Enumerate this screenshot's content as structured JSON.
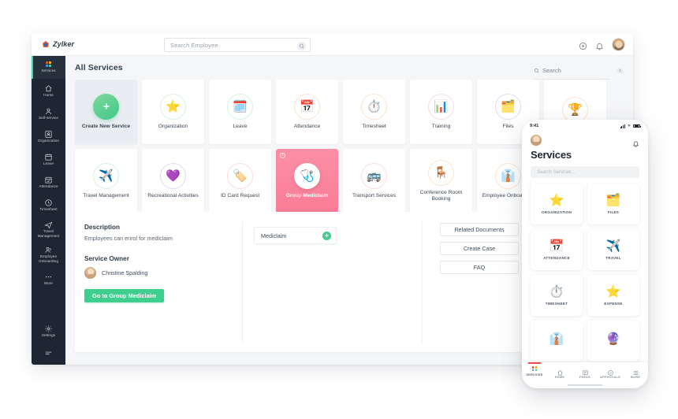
{
  "topbar": {
    "logo_text": "Zylker",
    "logo_icon": "zylker-logo-icon",
    "search_placeholder": "Search Employee",
    "search_value": "",
    "search_icon": "search-icon",
    "add_icon": "plus-circle-icon",
    "bell_icon": "bell-icon",
    "avatar": "user-avatar"
  },
  "sidebar": {
    "items": [
      {
        "label": "Services",
        "icon": "grid-dots-icon",
        "active": true
      },
      {
        "label": "Home",
        "icon": "home-icon",
        "active": false
      },
      {
        "label": "Self-service",
        "icon": "person-icon",
        "active": false
      },
      {
        "label": "Organization",
        "icon": "organization-icon",
        "active": false
      },
      {
        "label": "Leave",
        "icon": "calendar-icon",
        "active": false
      },
      {
        "label": "Attendance",
        "icon": "attendance-calendar-icon",
        "active": false
      },
      {
        "label": "Timesheet",
        "icon": "clock-icon",
        "active": false
      },
      {
        "label": "Travel Management",
        "icon": "airplane-icon",
        "active": false
      },
      {
        "label": "Employee Onboarding",
        "icon": "people-icon",
        "active": false
      },
      {
        "label": "More",
        "icon": "ellipsis-icon",
        "active": false
      }
    ],
    "bottom_items": [
      {
        "label": "Settings",
        "icon": "gear-icon"
      }
    ],
    "collapse_icon": "hamburger-collapse-icon",
    "accent_color": "#3fd6a6",
    "background_color": "#1d2733"
  },
  "main": {
    "page_title": "All Services",
    "search_placeholder": "Search",
    "search_icon": "search-icon",
    "settings_icon": "gear-icon",
    "cards_row1": [
      {
        "label": "Create New Service",
        "icon": "plus-icon",
        "style": "create"
      },
      {
        "label": "Organization",
        "icon": "star-emoji",
        "glyph": "⭐",
        "ring": "ring-green"
      },
      {
        "label": "Leave",
        "icon": "calendar-emoji",
        "glyph": "🗓️",
        "ring": "ring-green"
      },
      {
        "label": "Attendance",
        "icon": "calendar-check-emoji",
        "glyph": "📅",
        "ring": "ring-orange"
      },
      {
        "label": "Timesheet",
        "icon": "stopwatch-emoji",
        "glyph": "⏱️",
        "ring": "ring-orange"
      },
      {
        "label": "Training",
        "icon": "presentation-emoji",
        "glyph": "📊",
        "ring": "ring-pink"
      },
      {
        "label": "Files",
        "icon": "folder-emoji",
        "glyph": "🗂️",
        "ring": "ring-purple"
      },
      {
        "label": "",
        "icon": "trophy-emoji",
        "glyph": "🏆",
        "ring": "ring-orange"
      }
    ],
    "cards_row2": [
      {
        "label": "Travel Management",
        "icon": "airplane-emoji",
        "glyph": "✈️",
        "ring": "ring-green"
      },
      {
        "label": "Recreational Activities",
        "icon": "globe-heart-emoji",
        "glyph": "💜",
        "ring": "ring-purple"
      },
      {
        "label": "ID Card Request",
        "icon": "tag-emoji",
        "glyph": "🏷️",
        "ring": "ring-pink"
      },
      {
        "label": "Group Mediclaim",
        "icon": "medical-kit-emoji",
        "glyph": "🩺",
        "style": "highlight",
        "info_badge": "i"
      },
      {
        "label": "Transport Services",
        "icon": "bus-emoji",
        "glyph": "🚌",
        "ring": "ring-pink"
      },
      {
        "label": "Conference Room Booking",
        "icon": "chair-emoji",
        "glyph": "🪑",
        "ring": "ring-orange"
      },
      {
        "label": "Employee Onboarding",
        "icon": "office-worker-emoji",
        "glyph": "👔",
        "ring": "ring-orange"
      }
    ],
    "highlight_color": "#f97c96",
    "accent_green": "#3ecf8e"
  },
  "detail": {
    "description_heading": "Description",
    "description_text": "Employees can enrol for mediclaim",
    "owner_heading": "Service Owner",
    "owner_name": "Christine Spalding",
    "owner_avatar": "owner-avatar",
    "cta_label": "Go to Group Mediclaim",
    "sub_item": {
      "label": "Mediclaim",
      "add_icon": "plus-icon"
    },
    "buttons": [
      {
        "label": "Related Documents"
      },
      {
        "label": "Create Case"
      },
      {
        "label": "FAQ"
      }
    ]
  },
  "phone": {
    "status_time": "9:41",
    "signal_icon": "signal-bars-icon",
    "wifi_icon": "wifi-icon",
    "battery_icon": "battery-icon",
    "avatar": "user-avatar",
    "bell_icon": "bell-icon",
    "title": "Services",
    "search_placeholder": "Search Services...",
    "tiles": [
      {
        "label": "ORGANIZATION",
        "icon": "star-emoji",
        "glyph": "⭐"
      },
      {
        "label": "FILES",
        "icon": "folder-emoji",
        "glyph": "🗂️"
      },
      {
        "label": "ATTENDANCE",
        "icon": "calendar-check-emoji",
        "glyph": "📅"
      },
      {
        "label": "TRAVEL",
        "icon": "airplane-emoji",
        "glyph": "✈️"
      },
      {
        "label": "TIMESHEET",
        "icon": "stopwatch-emoji",
        "glyph": "⏱️"
      },
      {
        "label": "EXPENSE",
        "icon": "star-emoji",
        "glyph": "⭐"
      },
      {
        "label": "",
        "icon": "onboarding-emoji",
        "glyph": "👔"
      },
      {
        "label": "",
        "icon": "help-emoji",
        "glyph": "🔮"
      }
    ],
    "bottom_nav": [
      {
        "label": "SERVICES",
        "icon": "grid-dots-icon",
        "active": true
      },
      {
        "label": "HOME",
        "icon": "home-icon",
        "active": false
      },
      {
        "label": "FEEDS",
        "icon": "feeds-icon",
        "active": false
      },
      {
        "label": "APPROVALS",
        "icon": "approvals-icon",
        "active": false
      },
      {
        "label": "MORE",
        "icon": "hamburger-icon",
        "active": false
      }
    ],
    "active_indicator_color": "#ef4b4b"
  }
}
